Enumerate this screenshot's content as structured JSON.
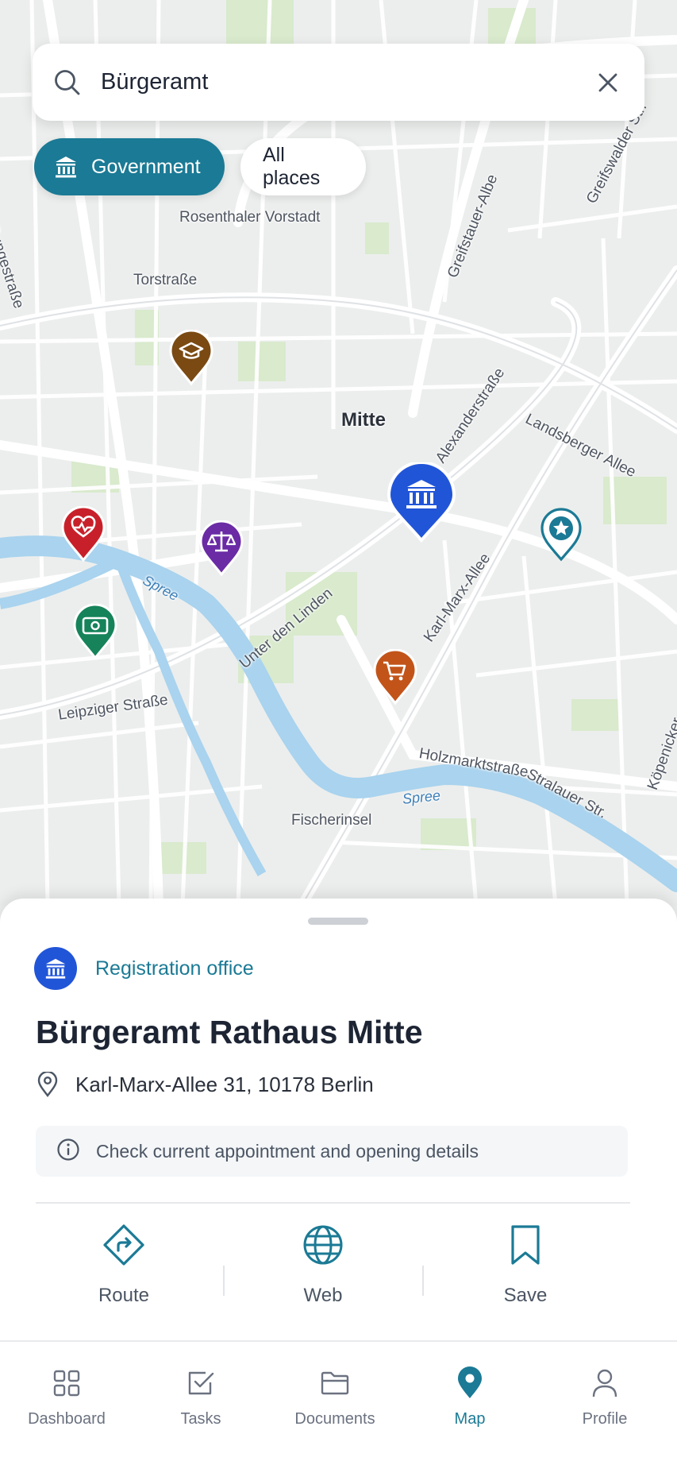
{
  "search": {
    "value": "Bürgeramt",
    "icon": "search-icon",
    "clear_icon": "close-icon"
  },
  "filters": [
    {
      "label": "Government",
      "active": true,
      "icon": "government-building-icon"
    },
    {
      "label": "All places",
      "active": false
    }
  ],
  "map": {
    "labels": {
      "rosenthaler": "Rosenthaler Vorstadt",
      "torstrasse": "Torstraße",
      "mitte": "Mitte",
      "rungestrasse": "Rungestraße",
      "greifswalder": "Greifswalder Str.",
      "greifstauer": "Greifstauer-Albe",
      "alexanderstrasse": "Alexanderstraße",
      "landsberger": "Landsberger Allee",
      "unter_den_linden": "Unter den Linden",
      "karl_marx_allee": "Karl-Marx-Allee",
      "leipziger": "Leipziger Straße",
      "holzmarkt": "Holzmarktstraße",
      "stralauer": "Stralauer Str.",
      "koepenicker": "Köpenicker",
      "spree_1": "Spree",
      "spree_2": "Spree",
      "fischerinsel": "Fischerinsel"
    },
    "pins": [
      {
        "name": "education-pin",
        "icon": "graduation-cap-icon",
        "color": "#7a4a12"
      },
      {
        "name": "health-pin",
        "icon": "heart-pulse-icon",
        "color": "#c8202a"
      },
      {
        "name": "legal-pin",
        "icon": "scales-icon",
        "color": "#6a2ba5"
      },
      {
        "name": "bank-pin",
        "icon": "banknote-icon",
        "color": "#16835a"
      },
      {
        "name": "selected-government-pin",
        "icon": "government-building-icon",
        "color": "#2155d8"
      },
      {
        "name": "favorite-pin",
        "icon": "star-icon",
        "color": "#1b7a95"
      },
      {
        "name": "shopping-pin",
        "icon": "shopping-cart-icon",
        "color": "#c2541a"
      }
    ]
  },
  "place": {
    "category": "Registration office",
    "category_icon": "government-building-icon",
    "title": "Bürgeramt Rathaus Mitte",
    "address": "Karl-Marx-Allee 31, 10178 Berlin",
    "address_icon": "location-pin-icon",
    "info": "Check current appointment and opening details",
    "info_icon": "info-icon",
    "actions": [
      {
        "label": "Route",
        "icon": "route-icon"
      },
      {
        "label": "Web",
        "icon": "globe-icon"
      },
      {
        "label": "Save",
        "icon": "bookmark-icon"
      }
    ]
  },
  "tabs": [
    {
      "label": "Dashboard",
      "icon": "dashboard-grid-icon",
      "active": false
    },
    {
      "label": "Tasks",
      "icon": "checkbox-icon",
      "active": false
    },
    {
      "label": "Documents",
      "icon": "folder-icon",
      "active": false
    },
    {
      "label": "Map",
      "icon": "map-pin-icon",
      "active": true
    },
    {
      "label": "Profile",
      "icon": "user-icon",
      "active": false
    }
  ],
  "colors": {
    "accent": "#1b7a95",
    "selected_pin": "#2155d8",
    "water": "#a9d3ee",
    "park": "#d6e9c9"
  }
}
